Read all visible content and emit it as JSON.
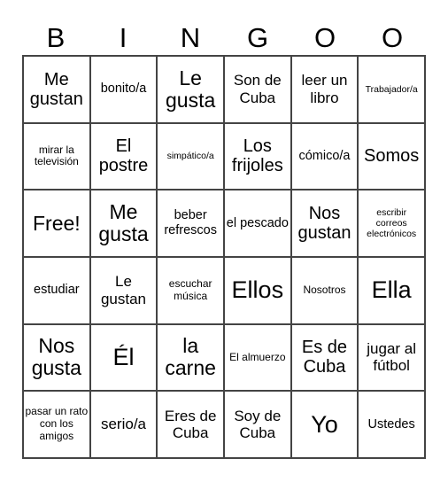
{
  "header": [
    "B",
    "I",
    "N",
    "G",
    "O",
    "O"
  ],
  "rows": [
    [
      {
        "text": "Me gustan",
        "size": "s20"
      },
      {
        "text": "bonito/a",
        "size": "s14"
      },
      {
        "text": "Le gusta",
        "size": "s22"
      },
      {
        "text": "Son de Cuba",
        "size": "s16"
      },
      {
        "text": "leer un libro",
        "size": "s16"
      },
      {
        "text": "Trabajador/a",
        "size": "s10"
      }
    ],
    [
      {
        "text": "mirar la televisión",
        "size": "s12"
      },
      {
        "text": "El postre",
        "size": "s20"
      },
      {
        "text": "simpático/a",
        "size": "s10"
      },
      {
        "text": "Los frijoles",
        "size": "s20"
      },
      {
        "text": "cómico/a",
        "size": "s14"
      },
      {
        "text": "Somos",
        "size": "s20"
      }
    ],
    [
      {
        "text": "Free!",
        "size": "s22"
      },
      {
        "text": "Me gusta",
        "size": "s22"
      },
      {
        "text": "beber refrescos",
        "size": "s14"
      },
      {
        "text": "el pescado",
        "size": "s14"
      },
      {
        "text": "Nos gustan",
        "size": "s20"
      },
      {
        "text": "escribir correos electrónicos",
        "size": "s10"
      }
    ],
    [
      {
        "text": "estudiar",
        "size": "s14"
      },
      {
        "text": "Le gustan",
        "size": "s16"
      },
      {
        "text": "escuchar música",
        "size": "s12"
      },
      {
        "text": "Ellos",
        "size": "s26"
      },
      {
        "text": "Nosotros",
        "size": "s12"
      },
      {
        "text": "Ella",
        "size": "s26"
      }
    ],
    [
      {
        "text": "Nos gusta",
        "size": "s22"
      },
      {
        "text": "Él",
        "size": "s26"
      },
      {
        "text": "la carne",
        "size": "s22"
      },
      {
        "text": "El almuerzo",
        "size": "s12"
      },
      {
        "text": "Es de Cuba",
        "size": "s20"
      },
      {
        "text": "jugar al fútbol",
        "size": "s16"
      }
    ],
    [
      {
        "text": "pasar un rato con los amigos",
        "size": "s12"
      },
      {
        "text": "serio/a",
        "size": "s16"
      },
      {
        "text": "Eres de Cuba",
        "size": "s16"
      },
      {
        "text": "Soy de Cuba",
        "size": "s16"
      },
      {
        "text": "Yo",
        "size": "s26"
      },
      {
        "text": "Ustedes",
        "size": "s14"
      }
    ]
  ]
}
